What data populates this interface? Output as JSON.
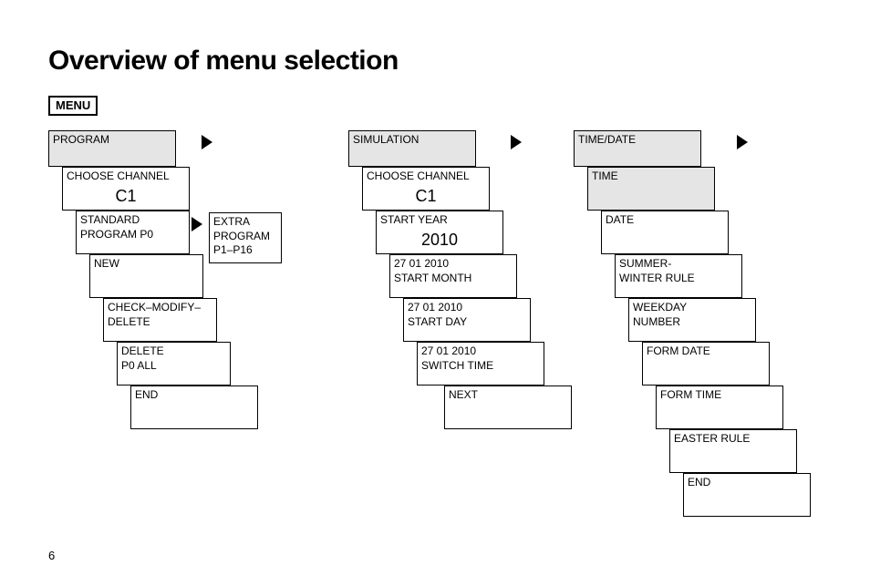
{
  "title": "Overview of menu selection",
  "menu_label": "MENU",
  "page_number": "6",
  "col1": {
    "top": "PROGRAM",
    "choose_channel": "CHOOSE CHANNEL",
    "choose_channel_val": "C1",
    "standard_program": "STANDARD\nPROGRAM P0",
    "extra_program": "EXTRA\nPROGRAM\nP1–P16",
    "new": "NEW",
    "check_mod_del": "CHECK–MODIFY–\nDELETE",
    "delete_all": "DELETE\nP0 ALL",
    "end": "END"
  },
  "col2": {
    "top": "SIMULATION",
    "choose_channel": "CHOOSE CHANNEL",
    "choose_channel_val": "C1",
    "start_year": "START YEAR",
    "start_year_val": "2010",
    "start_month_date": "27   01   2010",
    "start_month": "START MONTH",
    "start_day_date": "27   01   2010",
    "start_day": "START DAY",
    "switch_time_date": "27   01   2010",
    "switch_time": "SWITCH TIME",
    "next": "NEXT"
  },
  "col3": {
    "top": "TIME/DATE",
    "time": "TIME",
    "date": "DATE",
    "summer_winter": "SUMMER-\nWINTER RULE",
    "weekday_number": "WEEKDAY\nNUMBER",
    "form_date": "FORM DATE",
    "form_time": "FORM TIME",
    "easter_rule": "EASTER RULE",
    "end": "END"
  }
}
